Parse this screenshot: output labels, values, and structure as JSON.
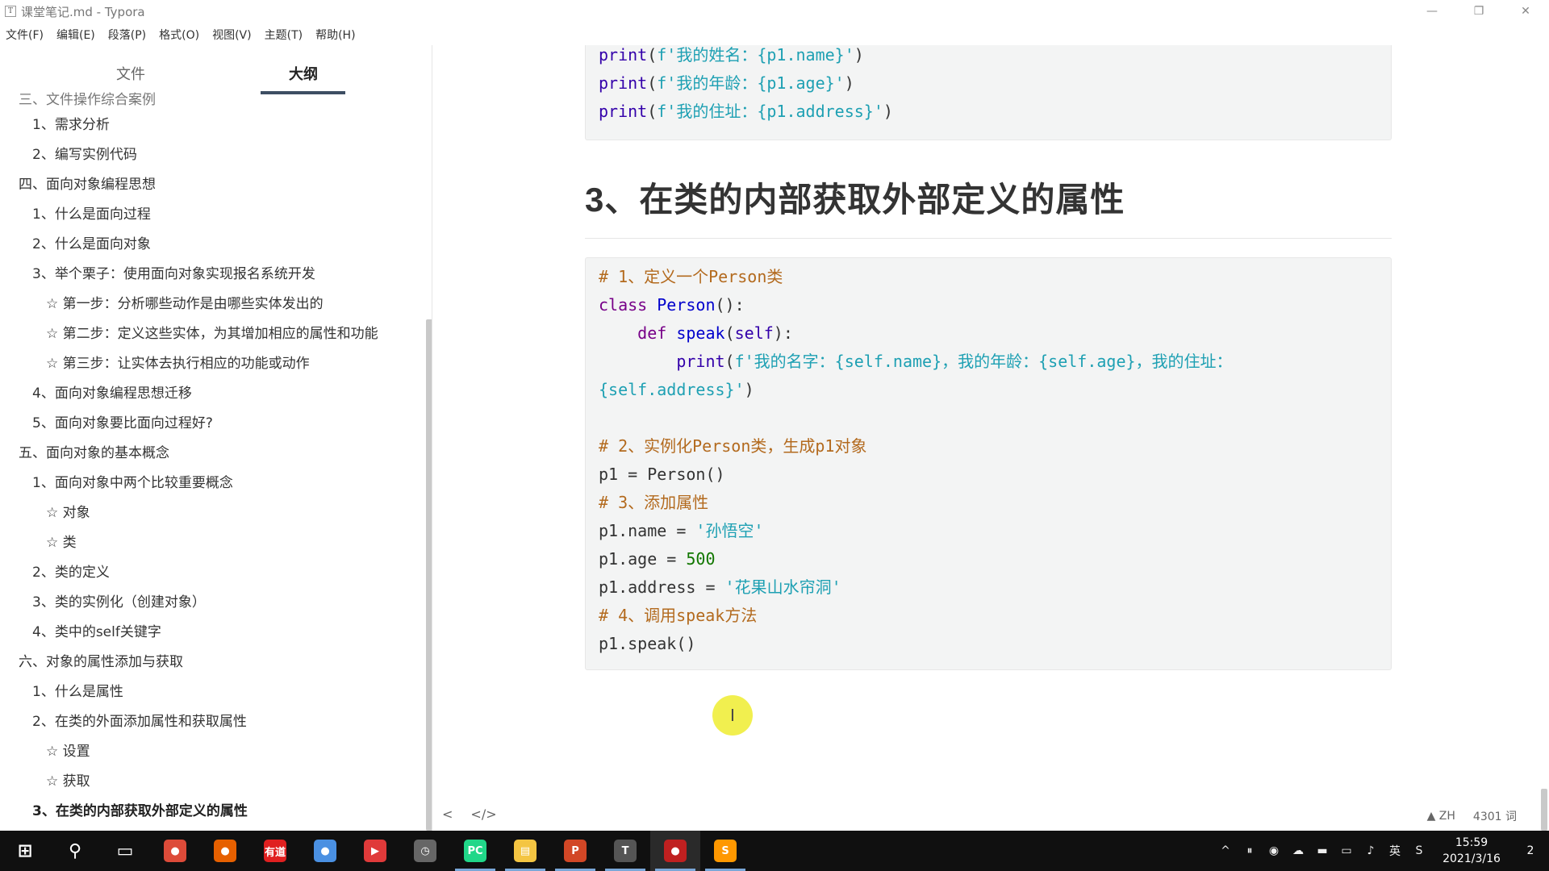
{
  "window": {
    "app_icon": "T",
    "title": "课堂笔记.md - Typora",
    "minimize": "—",
    "restore": "❐",
    "close": "✕"
  },
  "menu": [
    "文件(F)",
    "编辑(E)",
    "段落(P)",
    "格式(O)",
    "视图(V)",
    "主题(T)",
    "帮助(H)"
  ],
  "sidebar": {
    "tab_files": "文件",
    "tab_outline": "大纲",
    "cut_item": "三、文件操作综合案例",
    "outline": [
      {
        "level": 2,
        "text": "1、需求分析"
      },
      {
        "level": 2,
        "text": "2、编写实例代码"
      },
      {
        "level": 1,
        "text": "四、面向对象编程思想"
      },
      {
        "level": 2,
        "text": "1、什么是面向过程"
      },
      {
        "level": 2,
        "text": "2、什么是面向对象"
      },
      {
        "level": 2,
        "text": "3、举个栗子：使用面向对象实现报名系统开发"
      },
      {
        "level": 3,
        "text": "☆ 第一步：分析哪些动作是由哪些实体发出的"
      },
      {
        "level": 3,
        "text": "☆ 第二步：定义这些实体，为其增加相应的属性和功能"
      },
      {
        "level": 3,
        "text": "☆ 第三步：让实体去执行相应的功能或动作"
      },
      {
        "level": 2,
        "text": "4、面向对象编程思想迁移"
      },
      {
        "level": 2,
        "text": "5、面向对象要比面向过程好?"
      },
      {
        "level": 1,
        "text": "五、面向对象的基本概念"
      },
      {
        "level": 2,
        "text": "1、面向对象中两个比较重要概念"
      },
      {
        "level": 3,
        "text": "☆ 对象"
      },
      {
        "level": 3,
        "text": "☆ 类"
      },
      {
        "level": 2,
        "text": "2、类的定义"
      },
      {
        "level": 2,
        "text": "3、类的实例化（创建对象）"
      },
      {
        "level": 2,
        "text": "4、类中的self关键字"
      },
      {
        "level": 1,
        "text": "六、对象的属性添加与获取"
      },
      {
        "level": 2,
        "text": "1、什么是属性"
      },
      {
        "level": 2,
        "text": "2、在类的外面添加属性和获取属性"
      },
      {
        "level": 3,
        "text": "☆ 设置"
      },
      {
        "level": 3,
        "text": "☆ 获取"
      },
      {
        "level": 2,
        "text": "3、在类的内部获取外部定义的属性",
        "active": true
      }
    ]
  },
  "content": {
    "block1": [
      [
        {
          "c": "b",
          "t": "print"
        },
        {
          "c": "",
          "t": "("
        },
        {
          "c": "str",
          "t": "f'我的姓名：{p1.name}'"
        },
        {
          "c": "",
          "t": ")"
        }
      ],
      [
        {
          "c": "b",
          "t": "print"
        },
        {
          "c": "",
          "t": "("
        },
        {
          "c": "str",
          "t": "f'我的年龄：{p1.age}'"
        },
        {
          "c": "",
          "t": ")"
        }
      ],
      [
        {
          "c": "b",
          "t": "print"
        },
        {
          "c": "",
          "t": "("
        },
        {
          "c": "str",
          "t": "f'我的住址：{p1.address}'"
        },
        {
          "c": "",
          "t": ")"
        }
      ]
    ],
    "heading": "3、在类的内部获取外部定义的属性",
    "block2": [
      [
        {
          "c": "cm",
          "t": "# 1、定义一个Person类"
        }
      ],
      [
        {
          "c": "k",
          "t": "class"
        },
        {
          "c": "",
          "t": " "
        },
        {
          "c": "fn",
          "t": "Person"
        },
        {
          "c": "",
          "t": "():"
        }
      ],
      [
        {
          "c": "",
          "t": "    "
        },
        {
          "c": "k",
          "t": "def"
        },
        {
          "c": "",
          "t": " "
        },
        {
          "c": "fn",
          "t": "speak"
        },
        {
          "c": "",
          "t": "("
        },
        {
          "c": "b",
          "t": "self"
        },
        {
          "c": "",
          "t": "):"
        }
      ],
      [
        {
          "c": "",
          "t": "        "
        },
        {
          "c": "b",
          "t": "print"
        },
        {
          "c": "",
          "t": "("
        },
        {
          "c": "str",
          "t": "f'我的名字：{self.name}，我的年龄：{self.age}，我的住址："
        }
      ],
      [
        {
          "c": "str",
          "t": "{self.address}'"
        },
        {
          "c": "",
          "t": ")"
        }
      ],
      [
        {
          "c": "",
          "t": ""
        }
      ],
      [
        {
          "c": "cm",
          "t": "# 2、实例化Person类，生成p1对象"
        }
      ],
      [
        {
          "c": "",
          "t": "p1 = Person()"
        }
      ],
      [
        {
          "c": "cm",
          "t": "# 3、添加属性"
        }
      ],
      [
        {
          "c": "",
          "t": "p1.name = "
        },
        {
          "c": "str",
          "t": "'孙悟空'"
        }
      ],
      [
        {
          "c": "",
          "t": "p1.age = "
        },
        {
          "c": "num",
          "t": "500"
        }
      ],
      [
        {
          "c": "",
          "t": "p1.address = "
        },
        {
          "c": "str",
          "t": "'花果山水帘洞'"
        }
      ],
      [
        {
          "c": "cm",
          "t": "# 4、调用speak方法"
        }
      ],
      [
        {
          "c": "",
          "t": "p1.speak()"
        }
      ]
    ],
    "cursor_glyph": "I"
  },
  "status": {
    "back": "<",
    "source": "</>",
    "lang": "▲ ZH",
    "words": "4301 词"
  },
  "taskbar": {
    "apps": [
      {
        "name": "start-button",
        "glyph": "⊞",
        "color": "transparent"
      },
      {
        "name": "search-icon",
        "glyph": "⚲",
        "color": "transparent"
      },
      {
        "name": "task-view-icon",
        "glyph": "▭",
        "color": "transparent"
      },
      {
        "name": "chrome-icon",
        "glyph": "●",
        "color": "#dd4b39"
      },
      {
        "name": "firefox-icon",
        "glyph": "●",
        "color": "#e66000"
      },
      {
        "name": "youdao-icon",
        "glyph": "有道",
        "color": "#e02020"
      },
      {
        "name": "browser-icon",
        "glyph": "●",
        "color": "#4a90e2"
      },
      {
        "name": "video-app-icon",
        "glyph": "▶",
        "color": "#e03a3a"
      },
      {
        "name": "clock-app-icon",
        "glyph": "◷",
        "color": "#666666"
      },
      {
        "name": "pycharm-icon",
        "glyph": "PC",
        "color": "#21d789"
      },
      {
        "name": "file-explorer-icon",
        "glyph": "▤",
        "color": "#f4c542"
      },
      {
        "name": "powerpoint-icon",
        "glyph": "P",
        "color": "#d24726"
      },
      {
        "name": "typora-icon",
        "glyph": "T",
        "color": "#555555"
      },
      {
        "name": "recorder-icon",
        "glyph": "●",
        "color": "#c02020"
      },
      {
        "name": "sublime-icon",
        "glyph": "S",
        "color": "#ff9800"
      }
    ],
    "tray": [
      "^",
      "⏸",
      "◉",
      "☁",
      "▬",
      "▭",
      "♪",
      "英",
      "S"
    ],
    "time": "15:59",
    "date": "2021/3/16",
    "notifications": "2"
  }
}
